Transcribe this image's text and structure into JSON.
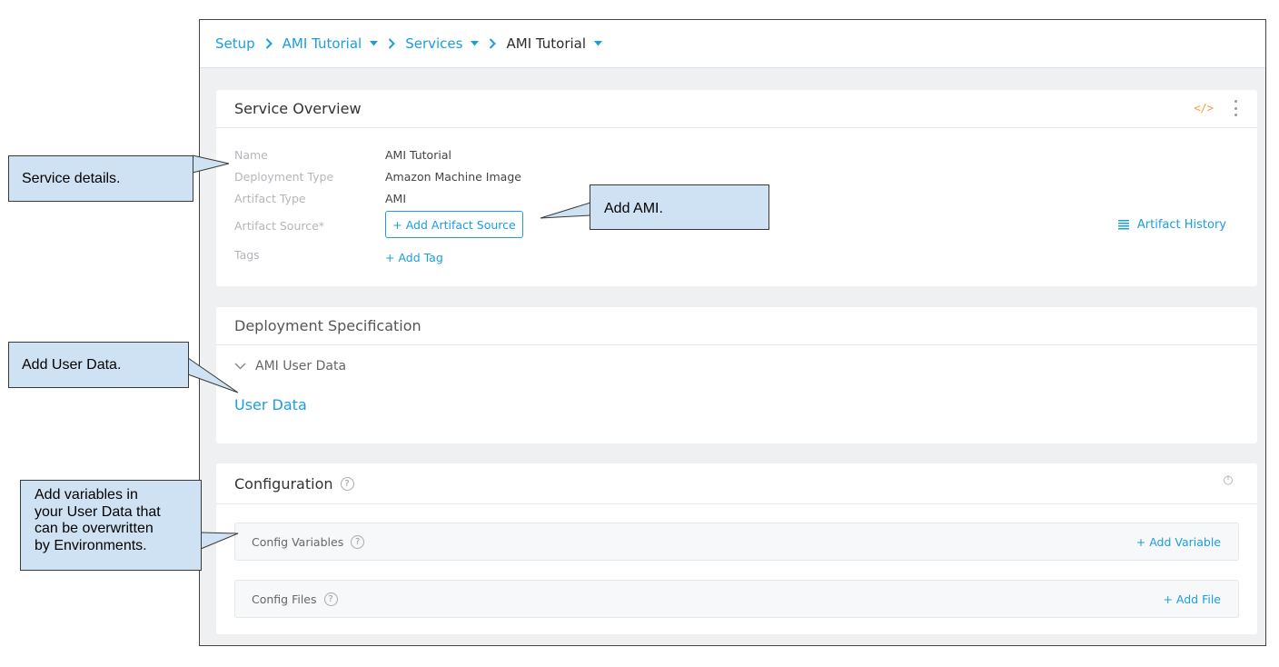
{
  "breadcrumb": {
    "setup": "Setup",
    "app": "AMI Tutorial",
    "services": "Services",
    "current": "AMI Tutorial"
  },
  "service_overview": {
    "title": "Service Overview",
    "code_icon_text": "</>",
    "fields": {
      "name_label": "Name",
      "name_value": "AMI Tutorial",
      "deploy_type_label": "Deployment Type",
      "deploy_type_value": "Amazon Machine Image",
      "artifact_type_label": "Artifact Type",
      "artifact_type_value": "AMI",
      "artifact_source_label": "Artifact Source*",
      "tags_label": "Tags"
    },
    "add_artifact_source": "+ Add Artifact Source",
    "add_tag": "+ Add Tag",
    "artifact_history": "Artifact History"
  },
  "deployment_spec": {
    "title": "Deployment Specification",
    "section": "AMI User Data",
    "user_data_link": "User Data"
  },
  "configuration": {
    "title": "Configuration",
    "config_variables": "Config Variables",
    "add_variable": "+ Add Variable",
    "config_files": "Config Files",
    "add_file": "+ Add File"
  },
  "callouts": {
    "service_details": "Service details.",
    "add_ami": "Add AMI.",
    "add_user_data": "Add User Data.",
    "add_variables_lines": [
      "Add variables in",
      "your User Data that",
      "can be overwritten",
      "by Environments."
    ]
  },
  "colors": {
    "accent": "#1a9ede",
    "callout_fill": "#cfe2f3",
    "code_icon": "#f39c40"
  }
}
